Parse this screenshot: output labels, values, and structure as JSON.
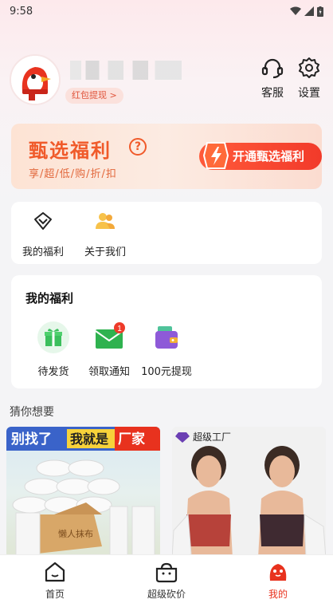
{
  "status_bar": {
    "time": "9:58"
  },
  "profile": {
    "redpack_label": "红包提现 >",
    "service_label": "客服",
    "settings_label": "设置"
  },
  "banner": {
    "title": "甄选福利",
    "help": "?",
    "subtitle": "享/超/低/购/折/扣",
    "button_label": "开通甄选福利"
  },
  "quick_links": [
    {
      "label": "我的福利",
      "icon": "diamond-icon"
    },
    {
      "label": "关于我们",
      "icon": "people-icon"
    }
  ],
  "welfare": {
    "title": "我的福利",
    "items": [
      {
        "label": "待发货",
        "icon": "gift-icon"
      },
      {
        "label": "领取通知",
        "icon": "mail-icon",
        "badge": "1"
      },
      {
        "label": "100元提现",
        "icon": "wallet-icon"
      }
    ]
  },
  "guess": {
    "title": "猜你想要",
    "products": [
      {
        "banner_1": "别找了",
        "banner_2": "我就是",
        "banner_3": "厂家",
        "box_text": "懒人抹布"
      },
      {
        "brand": "超级工厂"
      }
    ]
  },
  "tabbar": [
    {
      "label": "首页",
      "icon": "home-icon"
    },
    {
      "label": "超级砍价",
      "icon": "pot-icon"
    },
    {
      "label": "我的",
      "icon": "mascot-icon"
    }
  ],
  "colors": {
    "accent": "#e8321e",
    "banner_orange": "#f05a2a"
  }
}
